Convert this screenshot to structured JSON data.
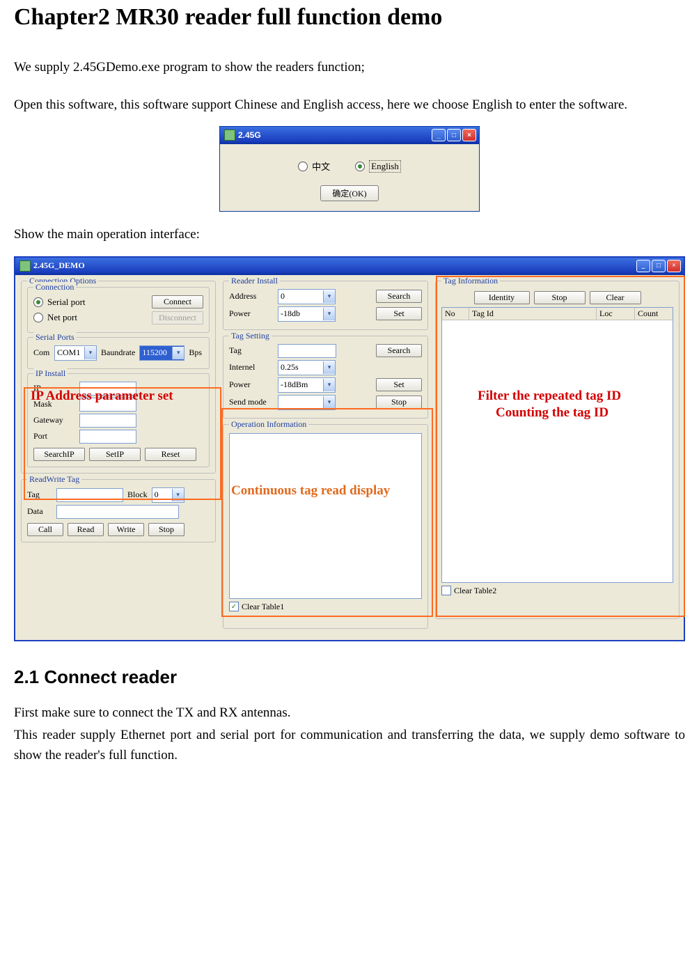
{
  "doc": {
    "chapter_title": "Chapter2 MR30 reader full function demo",
    "p1": "We supply 2.45GDemo.exe program to show the readers function;",
    "p2": "Open this software, this software support Chinese and English access, here we choose English to enter the software.",
    "p3": "Show the main operation interface:",
    "section_title": "2.1  Connect reader",
    "p4": "First make sure to connect the TX and RX antennas.",
    "p5": "This reader supply Ethernet port and serial port for communication and transferring the data, we supply demo software to show the reader's full function."
  },
  "lang_window": {
    "title": "2.45G",
    "opt_cn": "中文",
    "opt_en": "English",
    "ok": "确定(OK)"
  },
  "demo_window": {
    "title": "2.45G_DEMO",
    "connection_options": {
      "legend": "Connection Options",
      "connection_legend": "Connection",
      "serial_port": "Serial port",
      "net_port": "Net port",
      "connect": "Connect",
      "disconnect": "Disconnect"
    },
    "serial_ports": {
      "legend": "Serial Ports",
      "com_label": "Com",
      "com_value": "COM1",
      "baud_label": "Baundrate",
      "baud_value": "115200",
      "bps": "Bps"
    },
    "ip_install": {
      "legend": "IP Install",
      "ip": "IP",
      "mask": "Mask",
      "gateway": "Gateway",
      "port": "Port",
      "search_ip": "SearchIP",
      "set_ip": "SetIP",
      "reset": "Reset"
    },
    "rw_tag": {
      "legend": "ReadWrite Tag",
      "tag": "Tag",
      "block": "Block",
      "block_val": "0",
      "data": "Data",
      "call": "Call",
      "read": "Read",
      "write": "Write",
      "stop": "Stop"
    },
    "reader_install": {
      "legend": "Reader Install",
      "address": "Address",
      "address_val": "0",
      "power": "Power",
      "power_val": "-18db",
      "search": "Search",
      "set": "Set"
    },
    "tag_setting": {
      "legend": "Tag Setting",
      "tag": "Tag",
      "internel": "Internel",
      "internel_val": "0.25s",
      "power": "Power",
      "power_val": "-18dBm",
      "send_mode": "Send mode",
      "search": "Search",
      "set": "Set",
      "stop": "Stop"
    },
    "operation_info": {
      "legend": "Operation Information",
      "clear_table1": "Clear Table1"
    },
    "tag_info": {
      "legend": "Tag Information",
      "identity": "Identity",
      "stop": "Stop",
      "clear": "Clear",
      "headers": {
        "no": "No",
        "tagid": "Tag Id",
        "loc": "Loc",
        "count": "Count"
      },
      "clear_table2": "Clear Table2"
    }
  },
  "annotations": {
    "ip_param": "IP Address parameter set",
    "cont_read": "Continuous tag read display",
    "filter_1": "Filter the repeated tag ID",
    "filter_2": "Counting the tag ID"
  }
}
